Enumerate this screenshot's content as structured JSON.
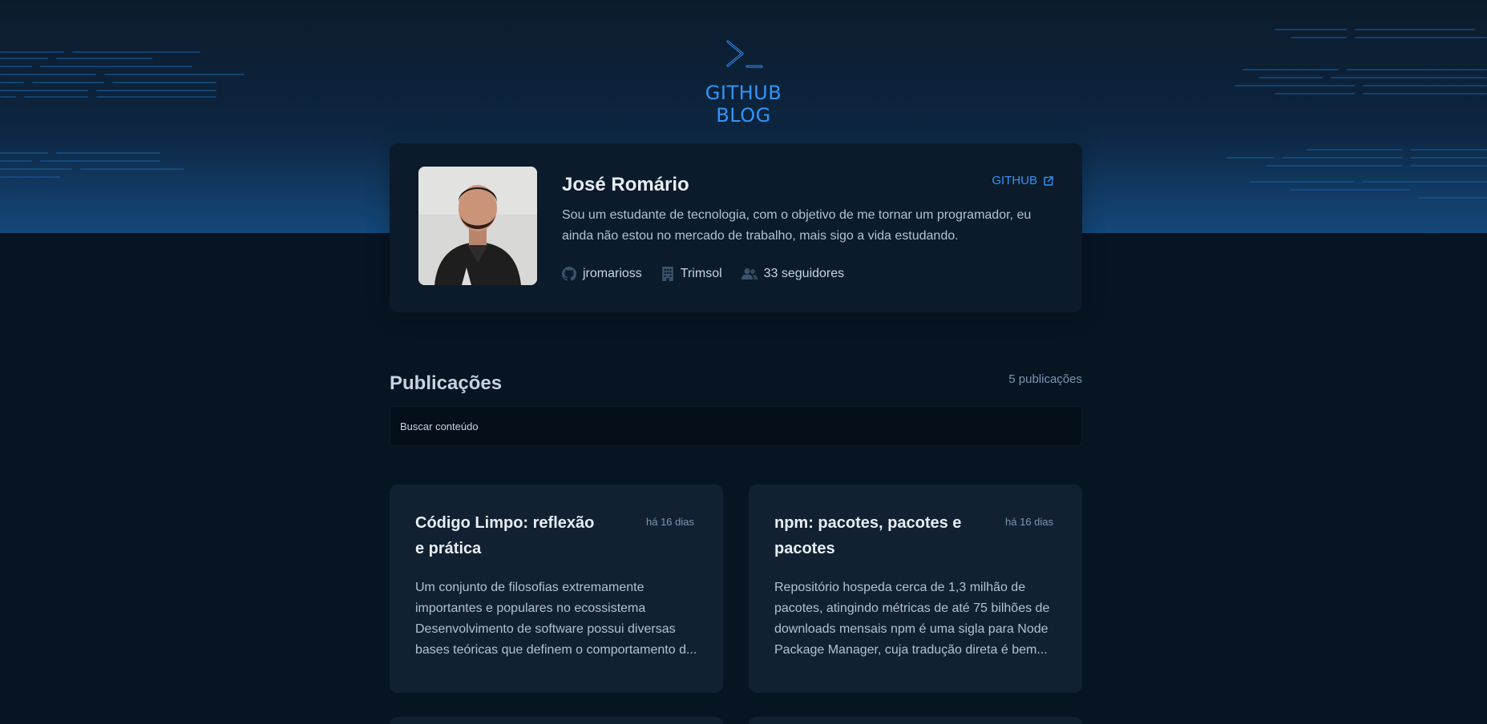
{
  "header": {
    "logo_text": "GITHUB BLOG"
  },
  "profile": {
    "name": "José Romário",
    "github_label": "GITHUB",
    "bio": "Sou um estudante de tecnologia, com o objetivo de me tornar um programador, eu ainda não estou no mercado de trabalho, mais sigo a vida estudando.",
    "username": "jromarioss",
    "company": "Trimsol",
    "followers": "33 seguidores"
  },
  "publications": {
    "title": "Publicações",
    "count": "5 publicações",
    "search_placeholder": "Buscar conteúdo",
    "posts": [
      {
        "title": "Código Limpo: reflexão e prática",
        "date": "há 16 dias",
        "excerpt": "Um conjunto de filosofias extremamente importantes e populares no ecossistema Desenvolvimento de software possui diversas bases teóricas que definem o comportamento d..."
      },
      {
        "title": "npm: pacotes, pacotes e pacotes",
        "date": "há 16 dias",
        "excerpt": "Repositório hospeda cerca de 1,3 milhão de pacotes, atingindo métricas de até 75 bilhões de downloads mensais npm é uma sigla para Node Package Manager, cuja tradução direta é bem..."
      }
    ]
  },
  "icons": {
    "logo": "terminal-prompt-icon",
    "github_link": "external-link-icon",
    "username": "github-icon",
    "company": "building-icon",
    "followers": "user-group-icon"
  },
  "colors": {
    "accent": "#3294F8",
    "background": "#071422",
    "profile_bg": "#0B1B2B",
    "card_bg": "#112131",
    "search_bg": "#040F1A"
  }
}
